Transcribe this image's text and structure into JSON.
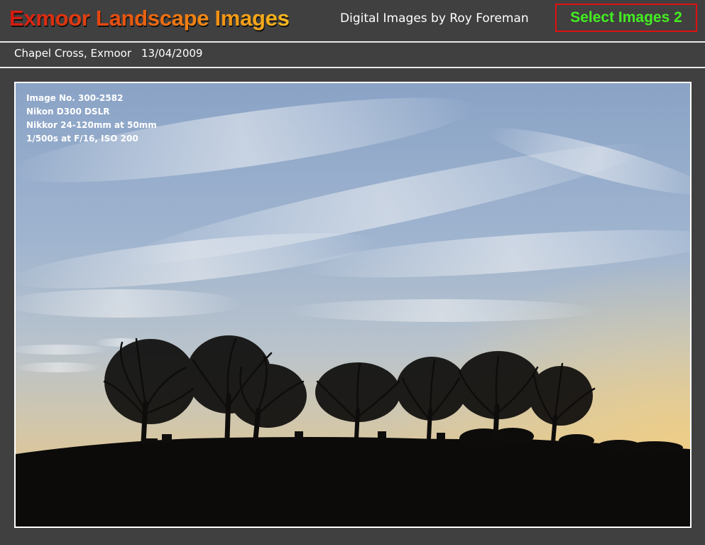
{
  "header": {
    "site_title": "Exmoor Landscape Images",
    "byline": "Digital Images by Roy Foreman",
    "select_button_label": "Select Images 2"
  },
  "caption": {
    "location": "Chapel Cross, Exmoor",
    "date": "13/04/2009"
  },
  "photo": {
    "meta": [
      "Image No. 300-2582",
      "Nikon D300 DSLR",
      "Nikkor 24-120mm at 50mm",
      "1/500s at F/16, ISO 200"
    ]
  },
  "colors": {
    "background": "#404040",
    "title_gradient_start": "#d41a10",
    "title_gradient_end": "#f6b81e",
    "select_button_text": "#44ee22",
    "select_button_border": "#e01010",
    "rule": "#e8e8e8"
  }
}
